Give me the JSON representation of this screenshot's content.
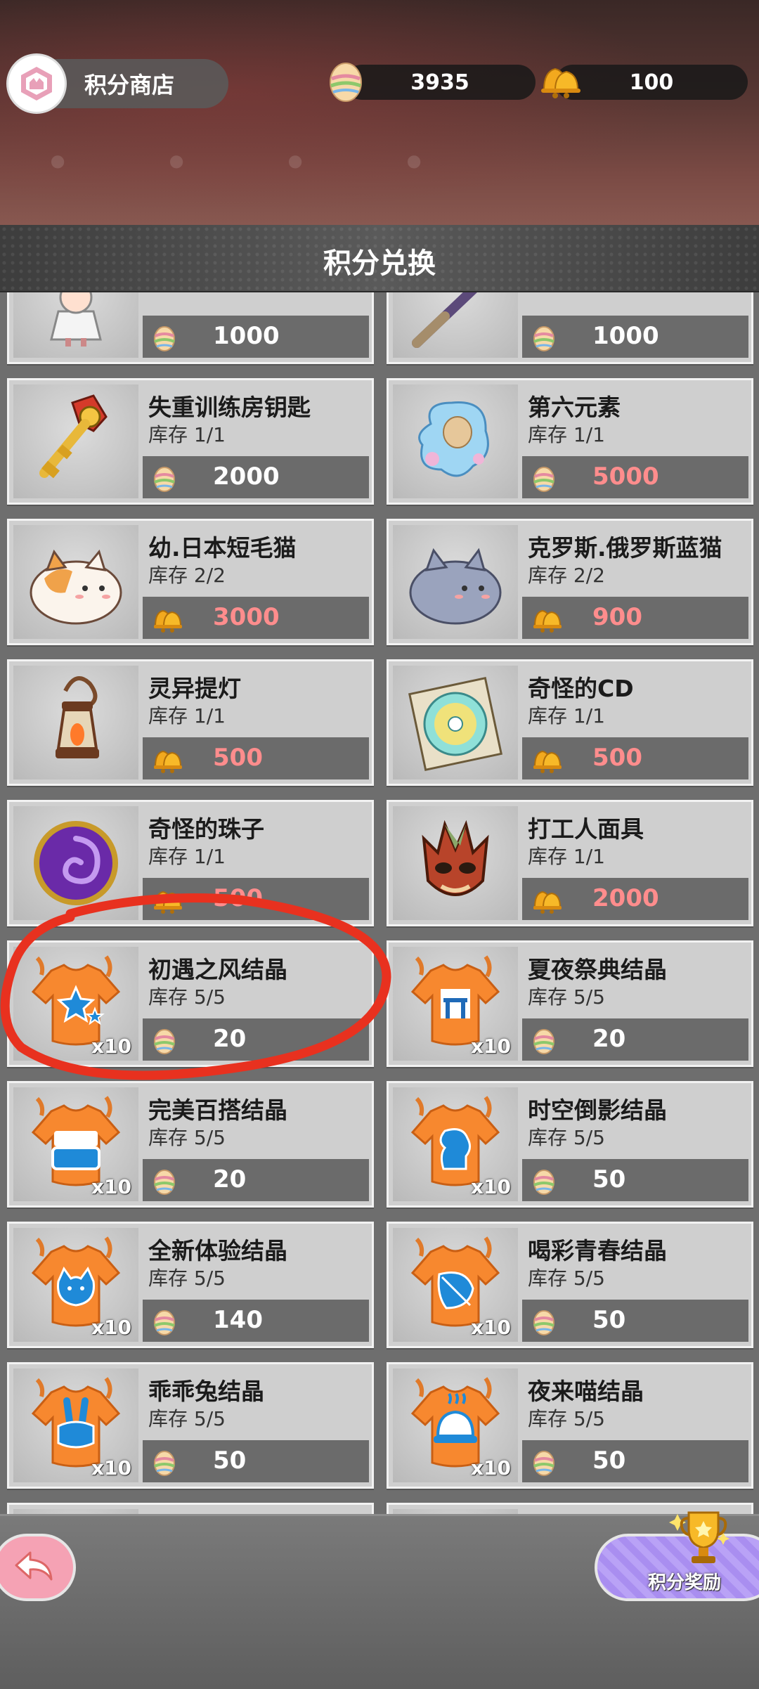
{
  "header": {
    "shop_title": "积分商店",
    "points_value": "3935",
    "bells_value": "100"
  },
  "section": {
    "title": "积分兑换"
  },
  "items": [
    {
      "name": "",
      "stock": "",
      "currency": "egg",
      "price": "1000",
      "price_color": "white",
      "icon": "doll-icon",
      "x10": false
    },
    {
      "name": "",
      "stock": "",
      "currency": "egg",
      "price": "1000",
      "price_color": "white",
      "icon": "stick-icon",
      "x10": false
    },
    {
      "name": "失重训练房钥匙",
      "stock": "库存 1/1",
      "currency": "egg",
      "price": "2000",
      "price_color": "white",
      "icon": "key-icon",
      "x10": false
    },
    {
      "name": "第六元素",
      "stock": "库存 1/1",
      "currency": "egg",
      "price": "5000",
      "price_color": "red",
      "icon": "bubble-icon",
      "x10": false
    },
    {
      "name": "幼.日本短毛猫",
      "stock": "库存 2/2",
      "currency": "bell",
      "price": "3000",
      "price_color": "red",
      "icon": "orange-cat-icon",
      "x10": false
    },
    {
      "name": "克罗斯.俄罗斯蓝猫",
      "stock": "库存 2/2",
      "currency": "bell",
      "price": "900",
      "price_color": "red",
      "icon": "blue-cat-icon",
      "x10": false
    },
    {
      "name": "灵异提灯",
      "stock": "库存 1/1",
      "currency": "bell",
      "price": "500",
      "price_color": "red",
      "icon": "lantern-icon",
      "x10": false
    },
    {
      "name": "奇怪的CD",
      "stock": "库存 1/1",
      "currency": "bell",
      "price": "500",
      "price_color": "red",
      "icon": "cd-icon",
      "x10": false
    },
    {
      "name": "奇怪的珠子",
      "stock": "库存 1/1",
      "currency": "bell",
      "price": "500",
      "price_color": "red",
      "icon": "orb-icon",
      "x10": false
    },
    {
      "name": "打工人面具",
      "stock": "库存 1/1",
      "currency": "bell",
      "price": "2000",
      "price_color": "red",
      "icon": "mask-icon",
      "x10": false
    },
    {
      "name": "初遇之风结晶",
      "stock": "库存 5/5",
      "currency": "egg",
      "price": "20",
      "price_color": "white",
      "icon": "star-shirt-icon",
      "x10": true
    },
    {
      "name": "夏夜祭典结晶",
      "stock": "库存 5/5",
      "currency": "egg",
      "price": "20",
      "price_color": "white",
      "icon": "kimono-shirt-icon",
      "x10": true
    },
    {
      "name": "完美百搭结晶",
      "stock": "库存 5/5",
      "currency": "egg",
      "price": "20",
      "price_color": "white",
      "icon": "text-shirt-icon",
      "x10": true
    },
    {
      "name": "时空倒影结晶",
      "stock": "库存 5/5",
      "currency": "egg",
      "price": "50",
      "price_color": "white",
      "icon": "profile-shirt-icon",
      "x10": true
    },
    {
      "name": "全新体验结晶",
      "stock": "库存 5/5",
      "currency": "egg",
      "price": "140",
      "price_color": "white",
      "icon": "cat-face-shirt-icon",
      "x10": true
    },
    {
      "name": "喝彩青春结晶",
      "stock": "库存 5/5",
      "currency": "egg",
      "price": "50",
      "price_color": "white",
      "icon": "leaf-shirt-icon",
      "x10": true
    },
    {
      "name": "乖乖兔结晶",
      "stock": "库存 5/5",
      "currency": "egg",
      "price": "50",
      "price_color": "white",
      "icon": "bunny-shirt-icon",
      "x10": true
    },
    {
      "name": "夜来喵结晶",
      "stock": "库存 5/5",
      "currency": "egg",
      "price": "50",
      "price_color": "white",
      "icon": "cloche-shirt-icon",
      "x10": true
    },
    {
      "name": "",
      "stock": "",
      "currency": "",
      "price": "",
      "price_color": "white",
      "icon": "shirt-icon",
      "x10": false
    },
    {
      "name": "",
      "stock": "",
      "currency": "",
      "price": "",
      "price_color": "white",
      "icon": "shirt-icon",
      "x10": false
    }
  ],
  "x10_label": "x10",
  "bottom": {
    "reward_label": "积分奖励"
  },
  "colors": {
    "price_red": "#ff8d8d",
    "annotation": "#e8311f",
    "reward": "#b9a2f6",
    "back": "#f5a2b4"
  }
}
